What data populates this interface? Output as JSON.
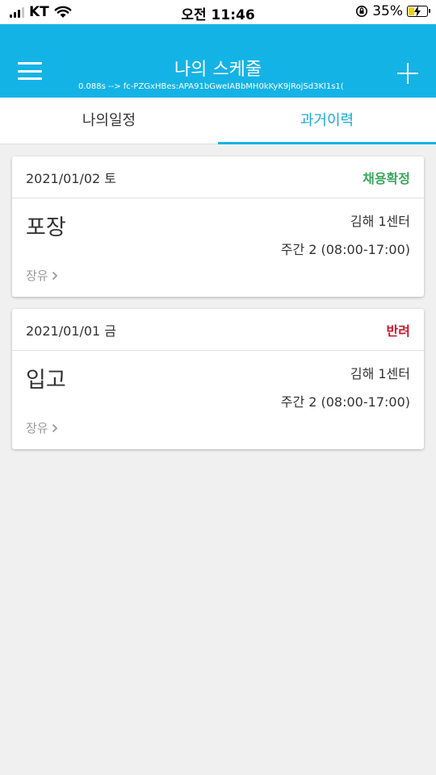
{
  "status_bar": {
    "carrier": "KT",
    "time": "오전 11:46",
    "battery_percent": "35%",
    "battery_level": 0.35
  },
  "header": {
    "title": "나의 스케줄",
    "subtitle": "0.088s --> fc-PZGxHBes:APA91bGweIABbMH0kKyK9jRojSd3Kl1s1(",
    "menu_icon": "hamburger-menu-icon",
    "add_icon": "plus-icon",
    "background_color": "#14b3e6"
  },
  "tabs": [
    {
      "label": "나의일정",
      "active": false
    },
    {
      "label": "과거이력",
      "active": true
    }
  ],
  "schedules": [
    {
      "date": "2021/01/02 토",
      "status": "채용확정",
      "status_color": "#3aa65c",
      "job": "포장",
      "location": "김해 1센터",
      "shift": "주간 2 (08:00-17:00)",
      "zone": "장유"
    },
    {
      "date": "2021/01/01 금",
      "status": "반려",
      "status_color": "#d0142c",
      "job": "입고",
      "location": "김해 1센터",
      "shift": "주간 2 (08:00-17:00)",
      "zone": "장유"
    }
  ]
}
